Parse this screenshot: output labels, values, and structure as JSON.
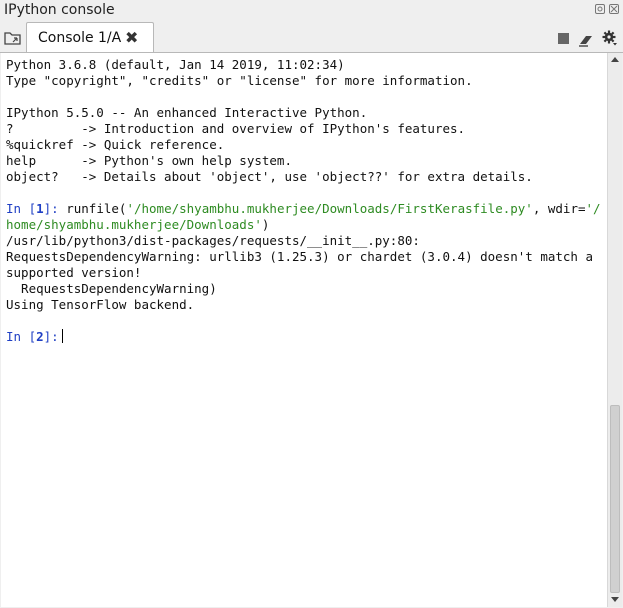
{
  "window": {
    "title": "IPython console",
    "title_icons": [
      "undock-icon",
      "close-pane-icon"
    ]
  },
  "tabs": [
    {
      "label": "Console 1/A",
      "close_glyph": "✖",
      "active": true
    }
  ],
  "toolbar": {
    "icons": [
      "browse-tabs-icon",
      "stop-icon",
      "clear-console-icon",
      "gear-icon"
    ]
  },
  "console": {
    "lines": [
      "Python 3.6.8 (default, Jan 14 2019, 11:02:34)",
      "Type \"copyright\", \"credits\" or \"license\" for more information.",
      "",
      "IPython 5.5.0 -- An enhanced Interactive Python.",
      "?         -> Introduction and overview of IPython's features.",
      "%quickref -> Quick reference.",
      "help      -> Python's own help system.",
      "object?   -> Details about 'object', use 'object??' for extra details.",
      ""
    ],
    "in1": {
      "prompt_prefix": "In [",
      "prompt_num": "1",
      "prompt_suffix": "]: ",
      "code_a": "runfile(",
      "str_a": "'/home/shyambhu.mukherjee/Downloads/FirstKerasfile.py'",
      "code_b": ", wdir=",
      "str_b1": "'/",
      "str_b2": "home/shyambhu.mukherjee/Downloads'",
      "code_c": ")"
    },
    "output": [
      "/usr/lib/python3/dist-packages/requests/__init__.py:80:",
      "RequestsDependencyWarning: urllib3 (1.25.3) or chardet (3.0.4) doesn't match a",
      "supported version!",
      "  RequestsDependencyWarning)",
      "Using TensorFlow backend.",
      ""
    ],
    "in2": {
      "prompt_prefix": "In [",
      "prompt_num": "2",
      "prompt_suffix": "]:"
    }
  },
  "colors": {
    "prompt": "#1f3fc4",
    "string": "#2e8b22",
    "text": "#111111"
  }
}
